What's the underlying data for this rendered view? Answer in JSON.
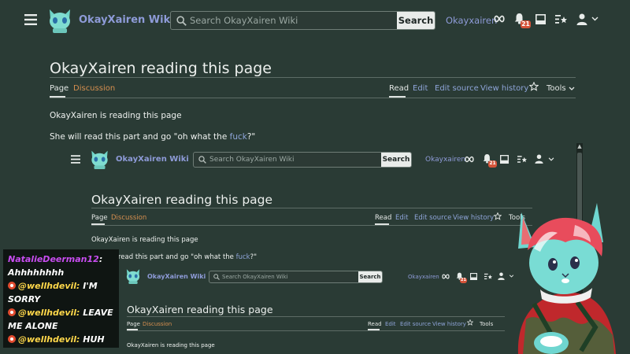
{
  "site": {
    "brand": "OkayXairen Wiki",
    "search_placeholder": "Search OkayXairen Wiki",
    "search_button": "Search",
    "username": "Okayxairen",
    "notification_count": "21"
  },
  "page": {
    "title": "OkayXairen reading this page",
    "tabs": {
      "page": "Page",
      "discussion": "Discussion",
      "read": "Read",
      "edit": "Edit",
      "edit_source": "Edit source",
      "view_history": "View history",
      "tools": "Tools"
    },
    "para1": "OkayXairen is reading this page",
    "para2_prefix": "She will read this part and go \"oh what the ",
    "para2_link": "fuck",
    "para2_suffix": "?\"",
    "para2_partial_prefix": "read this part and go \"oh what the "
  },
  "chat": {
    "messages": [
      {
        "user": "NatalieDeerman12",
        "text": "Ahhhhhhhh"
      },
      {
        "reply_to": "@wellhdevil:",
        "text": "I'M SORRY"
      },
      {
        "reply_to": "@wellhdevil:",
        "text": "LEAVE ME ALONE"
      },
      {
        "reply_to": "@wellhdevil:",
        "text": "HUH"
      }
    ]
  },
  "colors": {
    "background": "#2a3b35",
    "link": "#8ea4d8",
    "brand": "#8e9bd8",
    "discussion": "#d68f4f",
    "badge": "#d5543a",
    "chat_username": "#c84df0",
    "chat_reply": "#ffd84a"
  },
  "icons": {
    "menu": "hamburger-icon",
    "logo": "cat-logo-icon",
    "search": "search-icon",
    "watchlist": "infinity-icon",
    "notifications": "bell-icon",
    "messages": "tray-icon",
    "watch_star": "star-icon",
    "user": "user-icon",
    "dropdown": "chevron-down-icon"
  }
}
